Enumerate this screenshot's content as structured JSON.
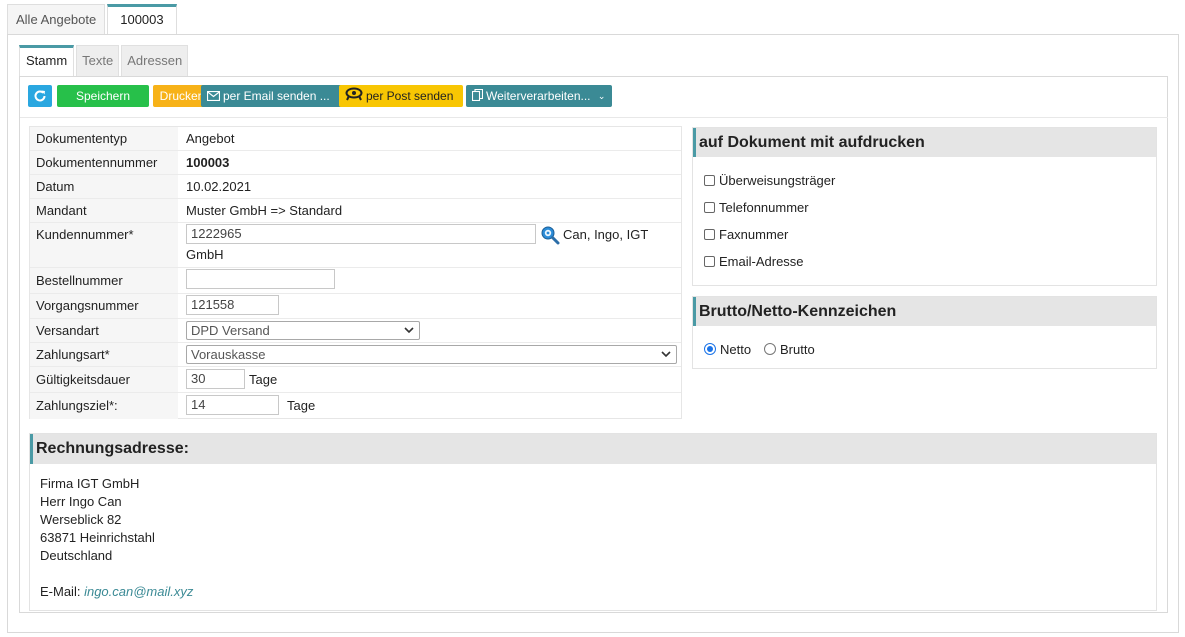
{
  "top_tabs": [
    {
      "label": "Alle Angebote",
      "active": false
    },
    {
      "label": "100003",
      "active": true
    }
  ],
  "inner_tabs": [
    {
      "label": "Stamm",
      "active": true
    },
    {
      "label": "Texte",
      "active": false
    },
    {
      "label": "Adressen",
      "active": false
    }
  ],
  "toolbar": {
    "refresh_icon": "refresh-icon",
    "save_label": "Speichern",
    "print_label": "Drucken",
    "email_label": "per Email senden ...",
    "post_label": "per Post senden",
    "next_label": "Weiterverarbeiten...",
    "colors": {
      "refresh": "#2aa7e0",
      "save": "#27c04a",
      "print": "#f7b218",
      "email": "#3b8a95",
      "post": "#f8c603"
    }
  },
  "form": {
    "doctype": {
      "label": "Dokumententyp",
      "value": "Angebot"
    },
    "docnum": {
      "label": "Dokumentennummer",
      "value": "100003"
    },
    "date": {
      "label": "Datum",
      "value": "10.02.2021"
    },
    "mandant": {
      "label": "Mandant",
      "value": "Muster GmbH => Standard"
    },
    "customer": {
      "label": "Kundennummer*",
      "value": "1222965",
      "name_line1": "Can, Ingo, IGT",
      "name_line2": "GmbH"
    },
    "order": {
      "label": "Bestellnummer",
      "value": ""
    },
    "process": {
      "label": "Vorgangsnummer",
      "value": "121558"
    },
    "shipping": {
      "label": "Versandart",
      "value": "DPD Versand"
    },
    "payment": {
      "label": "Zahlungsart*",
      "value": "Vorauskasse"
    },
    "validity": {
      "label": "Gültigkeitsdauer",
      "value": "30",
      "unit": "Tage"
    },
    "terms": {
      "label": "Zahlungsziel*:",
      "value": "14",
      "unit": "Tage"
    }
  },
  "print_options": {
    "title": "auf Dokument mit aufdrucken",
    "items": [
      {
        "label": "Überweisungsträger",
        "checked": false
      },
      {
        "label": "Telefonnummer",
        "checked": false
      },
      {
        "label": "Faxnummer",
        "checked": false
      },
      {
        "label": "Email-Adresse",
        "checked": false
      }
    ]
  },
  "gross_net": {
    "title": "Brutto/Netto-Kennzeichen",
    "options": [
      {
        "label": "Netto",
        "selected": true
      },
      {
        "label": "Brutto",
        "selected": false
      }
    ]
  },
  "address": {
    "title": "Rechnungsadresse:",
    "lines": [
      "Firma IGT GmbH",
      "Herr Ingo Can",
      "Werseblick 82",
      "63871 Heinrichstahl",
      "Deutschland"
    ],
    "email_label": "E-Mail:",
    "email": "ingo.can@mail.xyz"
  }
}
